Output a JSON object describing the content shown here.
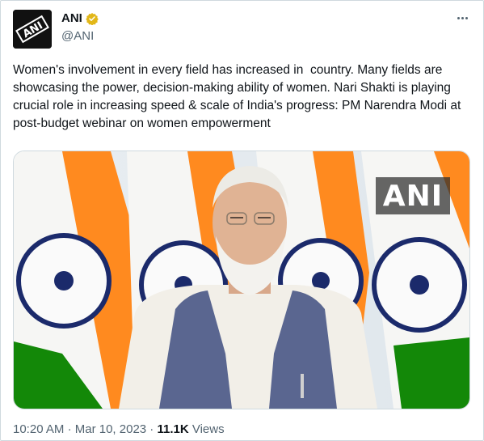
{
  "tweet": {
    "author_name": "ANI",
    "author_handle": "@ANI",
    "avatar_text": "ANI",
    "text": "Women's involvement in every field has increased in  country. Many fields are showcasing the power, decision-making ability of women. Nari Shakti is playing crucial role in increasing speed & scale of India's progress: PM Narendra Modi at post-budget webinar on women empowerment",
    "media_watermark": "ANI",
    "time": "10:20 AM",
    "separator": "·",
    "date": "Mar 10, 2023",
    "views_count": "11.1K",
    "views_label": "Views"
  },
  "icons": {
    "verified": "verified-badge-icon",
    "more": "more-options-icon"
  },
  "colors": {
    "verified_gold": "#e2b719",
    "text_primary": "#0f1419",
    "text_secondary": "#536471",
    "border": "#cfd9de",
    "saffron": "#ff8a1f",
    "green": "#138808",
    "chakra_navy": "#1b2a6b",
    "vest": "#5a6690"
  }
}
